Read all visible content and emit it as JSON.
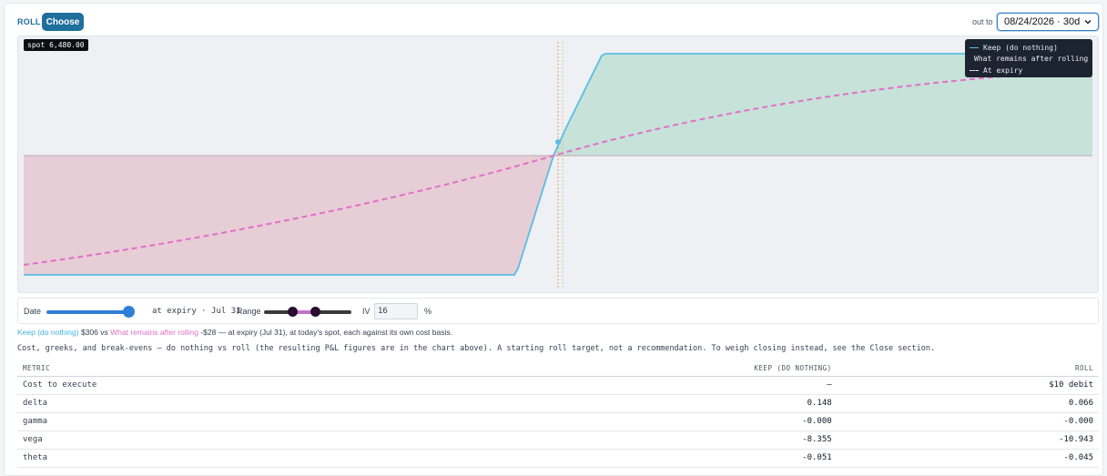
{
  "header": {
    "section_label": "ROLL",
    "choose_label": "Choose",
    "out_to_label": "out to",
    "expiry_select_value": "08/24/2026 · 30d"
  },
  "chart": {
    "spot_tag": "spot 6,480.00",
    "legend": [
      {
        "label": "Keep (do nothing)",
        "color": "#5bbde3",
        "style": "solid"
      },
      {
        "label": "What remains after rolling",
        "color": "#e070c8",
        "style": "dashed"
      },
      {
        "label": "At expiry",
        "color": "#e8edf3",
        "style": "dashed"
      }
    ],
    "colors": {
      "keep_line": "#5bbde3",
      "roll_line": "#e070c8",
      "profit_fill": "#c7e2d9",
      "loss_fill": "#e7cdd6",
      "spot_line": "#d9a05a"
    }
  },
  "controls": {
    "date_label": "Date",
    "date_slider_fraction": 1.0,
    "at_expiry_text": "at expiry · Jul 31",
    "range_label": "Range",
    "range_low_fraction": 0.33,
    "range_high_fraction": 0.59,
    "iv_label": "IV",
    "iv_value": "16",
    "iv_unit": "%"
  },
  "summary": {
    "keep_name": "Keep (do nothing)",
    "keep_value": "$306",
    "vs": "vs",
    "roll_name": "What remains after rolling",
    "roll_value": "-$28",
    "tail": "— at expiry (Jul 31), at today's spot, each against its own cost basis."
  },
  "description": "Cost, greeks, and break-evens — do nothing vs roll (the resulting P&L figures are in the chart above). A starting roll target, not a recommendation. To weigh closing instead, see the Close section.",
  "table": {
    "headers": [
      "METRIC",
      "KEEP (DO NOTHING)",
      "ROLL"
    ],
    "rows": [
      {
        "metric": "Cost to execute",
        "keep": "—",
        "roll": "$10 debit"
      },
      {
        "metric": "delta",
        "keep": "0.148",
        "roll": "0.066"
      },
      {
        "metric": "gamma",
        "keep": "-0.000",
        "roll": "-0.000"
      },
      {
        "metric": "vega",
        "keep": "-8.355",
        "roll": "-10.943"
      },
      {
        "metric": "theta",
        "keep": "-0.051",
        "roll": "-0.045"
      }
    ]
  }
}
